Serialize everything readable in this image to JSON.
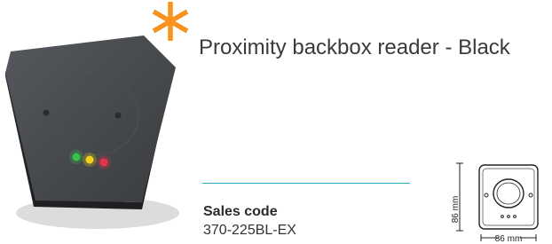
{
  "product": {
    "title": "Proximity backbox reader - Black",
    "sales_code_label": "Sales code",
    "sales_code": "370-225BL-EX"
  },
  "drawing": {
    "height_label": "86 mm",
    "width_label": "86 mm"
  },
  "colors": {
    "accent": "#f7941d",
    "divider": "#2aa6c7",
    "device_body": "#3d3f42",
    "led_green": "#35c24a",
    "led_yellow": "#f2d21b",
    "led_red": "#e8344a"
  },
  "icons": {
    "star": "asterisk-icon"
  }
}
